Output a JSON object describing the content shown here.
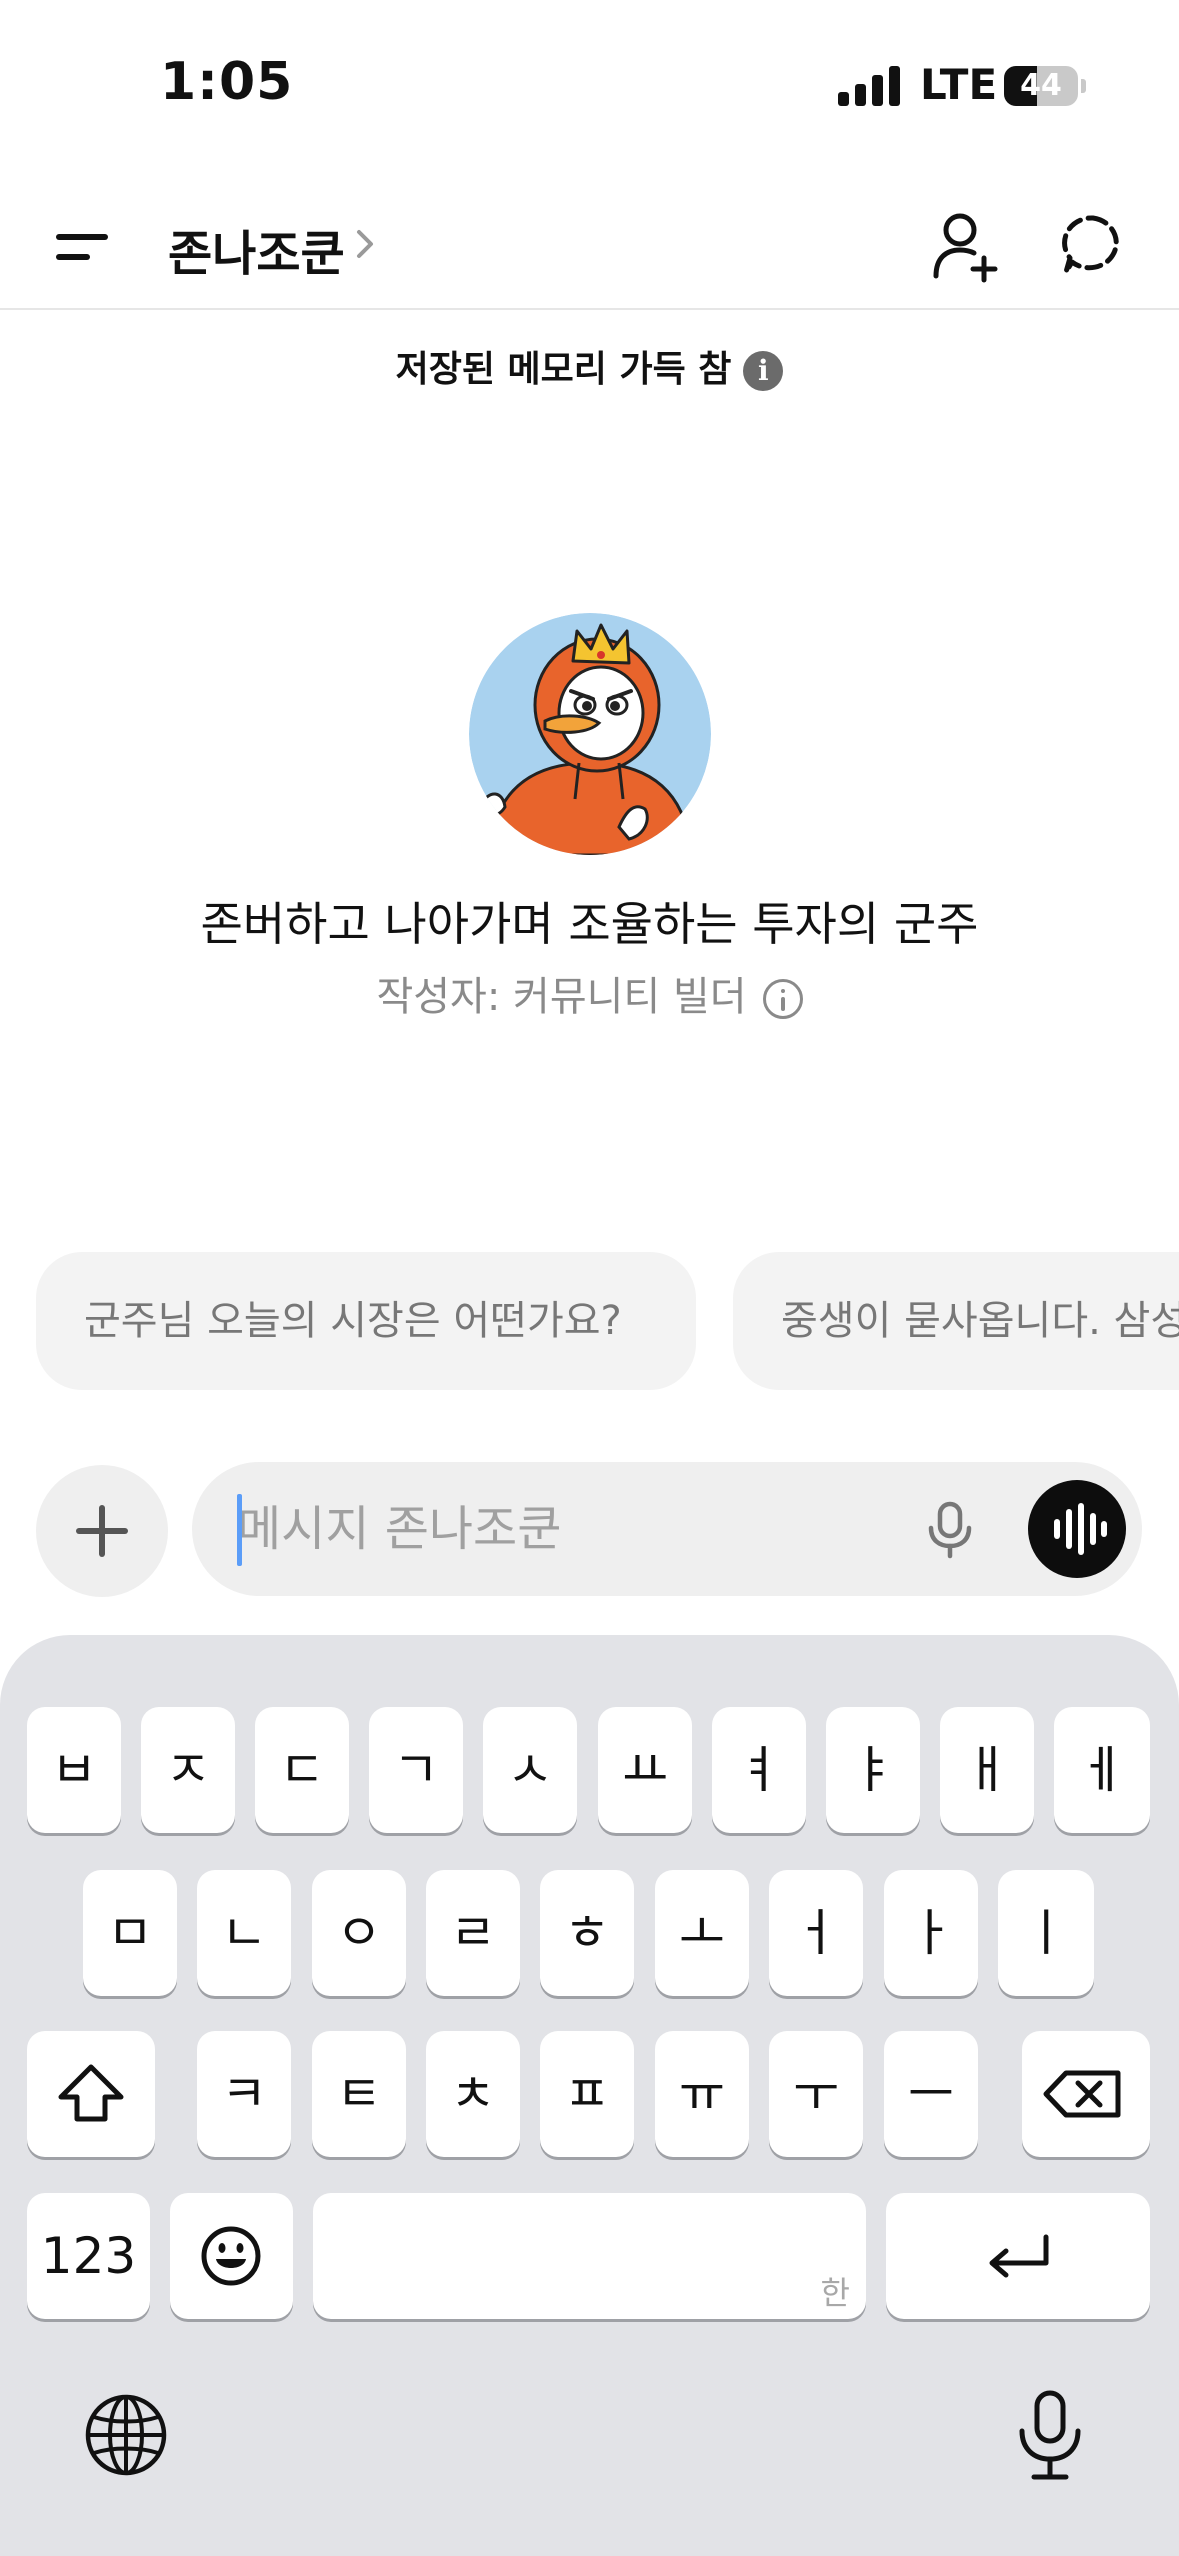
{
  "status_bar": {
    "time": "1:05",
    "network": "LTE",
    "battery": "44",
    "battery_level": 0.44
  },
  "header": {
    "title": "존나조쿤",
    "icons": [
      "menu-icon",
      "chevron-right-icon",
      "add-person-icon",
      "temporary-chat-icon"
    ]
  },
  "memory_banner": {
    "text": "저장된 메모리 가득 참",
    "info": "i"
  },
  "gpt": {
    "name": "존버하고 나아가며 조율하는 투자의 군주",
    "author": "작성자: 커뮤니티 빌더"
  },
  "suggestions": [
    {
      "text": "군주님 오늘의 시장은 어떤가요?"
    },
    {
      "text": "중생이 묻사옵니다. 삼성"
    }
  ],
  "composer": {
    "placeholder": "메시지 존나조쿤",
    "value": ""
  },
  "keyboard": {
    "row1": [
      "ㅂ",
      "ㅈ",
      "ㄷ",
      "ㄱ",
      "ㅅ",
      "ㅛ",
      "ㅕ",
      "ㅑ",
      "ㅐ",
      "ㅔ"
    ],
    "row2": [
      "ㅁ",
      "ㄴ",
      "ㅇ",
      "ㄹ",
      "ㅎ",
      "ㅗ",
      "ㅓ",
      "ㅏ",
      "ㅣ"
    ],
    "row3": [
      "ㅋ",
      "ㅌ",
      "ㅊ",
      "ㅍ",
      "ㅠ",
      "ㅜ",
      "ㅡ"
    ],
    "numbers_key": "123",
    "space_hint": "한",
    "icons": [
      "shift-icon",
      "backspace-icon",
      "emoji-icon",
      "return-icon",
      "globe-icon",
      "dictation-mic-icon"
    ]
  },
  "colors": {
    "caret": "#5b9df8",
    "keyboard_bg": "#e2e3e7",
    "avatar_bg": "#a9d2ef",
    "hoodie": "#e8642c"
  }
}
